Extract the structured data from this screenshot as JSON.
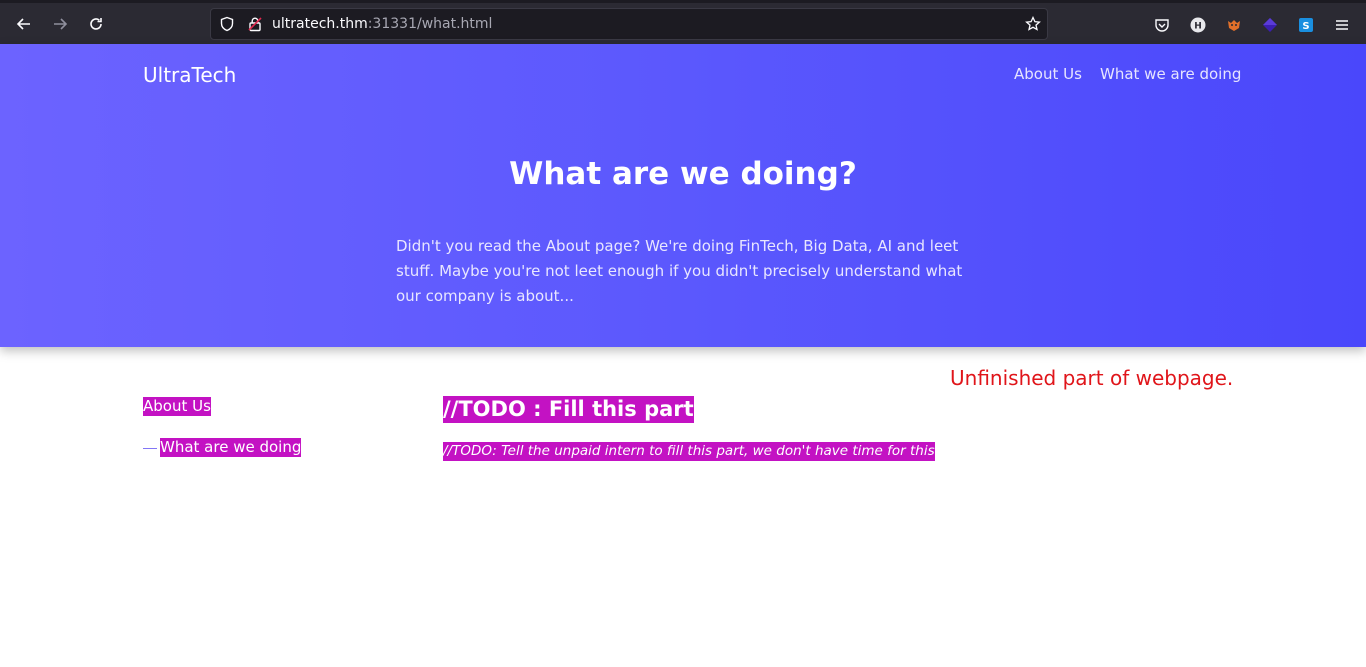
{
  "browser": {
    "url_host": "ultratech.thm",
    "url_rest": ":31331/what.html",
    "icons": [
      "back-icon",
      "forward-icon",
      "reload-icon",
      "shield-icon",
      "lock-icon",
      "bookmark-star-icon",
      "pocket-icon",
      "extension-h-icon",
      "extension-fox-icon",
      "extension-diamond-icon",
      "extension-s-icon",
      "menu-icon"
    ]
  },
  "header": {
    "brand": "UltraTech",
    "nav": [
      "About Us",
      "What we are doing"
    ]
  },
  "hero": {
    "title": "What are we doing?",
    "text": "Didn't you read the About page? We're doing FinTech, Big Data, AI and leet stuff. Maybe you're not leet enough if you didn't precisely understand what our company is about..."
  },
  "sidebar": {
    "items": [
      "About Us",
      "What are we doing"
    ],
    "active_marker": "—"
  },
  "main": {
    "title": "//TODO : Fill this part",
    "subtitle": "//TODO: Tell the unpaid intern to fill this part, we don't have time for this"
  },
  "annotation": "Unfinished part of webpage.",
  "colors": {
    "hero_gradient_start": "#6c63ff",
    "hero_gradient_end": "#4a47fb",
    "highlight": "#c312c3",
    "annotation": "#e0151a"
  }
}
